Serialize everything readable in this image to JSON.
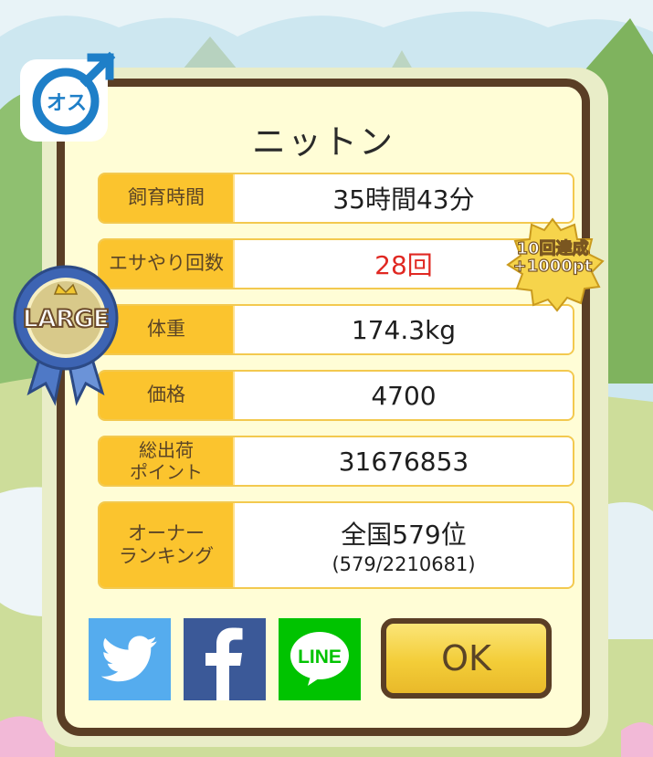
{
  "colors": {
    "frame": "#5a3e25",
    "panel": "#fffdd6",
    "label_bg": "#fbc42e",
    "highlight_value": "#e02822",
    "twitter": "#55acee",
    "facebook": "#3b5998",
    "line": "#00c300"
  },
  "gender_badge": {
    "icon": "male-symbol-icon",
    "text": "オス"
  },
  "title": "ニットン",
  "rows": [
    {
      "label": "飼育時間",
      "value": "35時間43分"
    },
    {
      "label": "エサやり回数",
      "value": "28回"
    },
    {
      "label": "体重",
      "value": "174.3kg"
    },
    {
      "label": "価格",
      "value": "4700"
    },
    {
      "label": "総出荷\nポイント",
      "value": "31676853"
    },
    {
      "label": "オーナー\nランキング",
      "value": "全国579位",
      "sub": "(579/2210681)"
    }
  ],
  "size_ribbon": {
    "text": "LARGE",
    "icon": "crown-icon"
  },
  "achievement_badge": {
    "line1": "10回達成",
    "line2": "+1000pt"
  },
  "share": {
    "twitter_icon": "twitter-bird-icon",
    "facebook_icon": "facebook-f-icon",
    "line_label": "LINE"
  },
  "ok_label": "OK"
}
